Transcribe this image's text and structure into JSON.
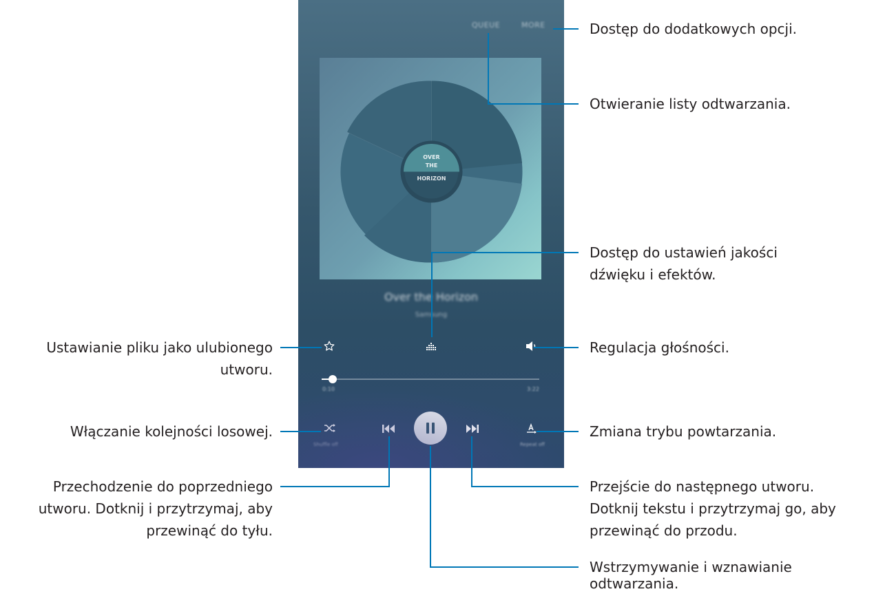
{
  "player": {
    "queue_label": "QUEUE",
    "more_label": "MORE",
    "album_title_line1": "OVER",
    "album_title_line2": "THE",
    "album_title_line3": "HORIZON",
    "song_title": "Over the Horizon",
    "artist": "Samsung",
    "time_elapsed": "0:10",
    "time_total": "3:22",
    "progress_fraction": 0.05,
    "shuffle_label": "Shuffle off",
    "repeat_label": "Repeat off"
  },
  "callouts": {
    "more": "Dostęp do dodatkowych opcji.",
    "queue": "Otwieranie listy odtwarzania.",
    "sound_line1": "Dostęp do ustawień jakości",
    "sound_line2": "dźwięku i efektów.",
    "favorite_line1": "Ustawianie pliku jako ulubionego",
    "favorite_line2": "utworu.",
    "volume": "Regulacja głośności.",
    "shuffle": "Włączanie kolejności losowej.",
    "repeat": "Zmiana trybu powtarzania.",
    "prev_line1": "Przechodzenie do poprzedniego",
    "prev_line2": "utworu. Dotknij i przytrzymaj, aby",
    "prev_line3": "przewinąć do tyłu.",
    "next_line1": "Przejście do następnego utworu.",
    "next_line2": "Dotknij tekstu i przytrzymaj go, aby",
    "next_line3": "przewinąć do przodu.",
    "pause_line1": "Wstrzymywanie i wznawianie",
    "pause_line2": "odtwarzania."
  },
  "colors": {
    "callout_line": "#0077b6",
    "text": "#231f20"
  },
  "icons": [
    "star-icon",
    "equalizer-icon",
    "volume-icon",
    "shuffle-icon",
    "previous-icon",
    "pause-icon",
    "next-icon",
    "repeat-icon"
  ]
}
